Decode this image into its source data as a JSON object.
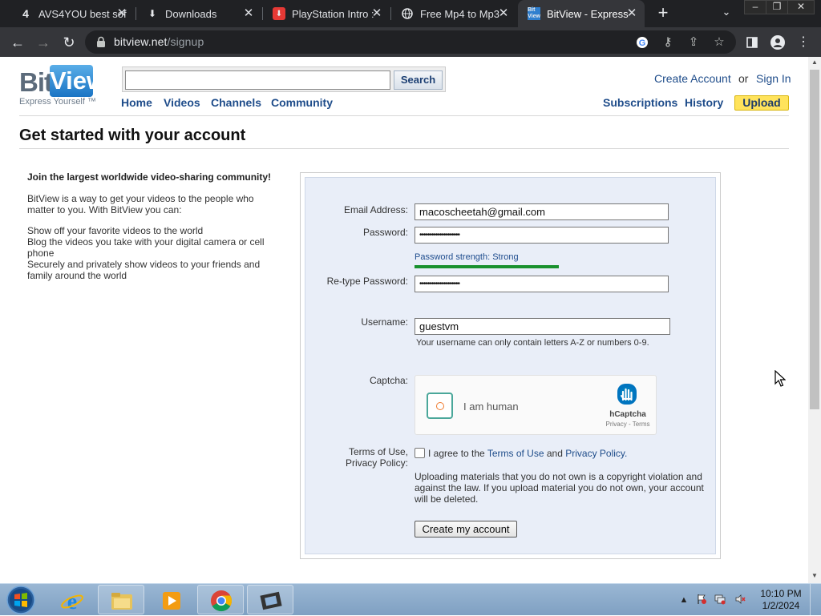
{
  "browser": {
    "tabs": [
      {
        "title": "AVS4YOU best sof",
        "icon": "4"
      },
      {
        "title": "Downloads",
        "icon": "download-icon"
      },
      {
        "title": "PlayStation Intro :",
        "icon": "download-red-icon"
      },
      {
        "title": "Free Mp4 to Mp3",
        "icon": "globe-icon"
      },
      {
        "title": "BitView - Express",
        "icon": "bitview-favicon"
      }
    ],
    "url_domain": "bitview.net",
    "url_path": "/signup"
  },
  "site": {
    "logo_bit": "Bit",
    "logo_view": "View",
    "tagline": "Express Yourself ™",
    "search_button": "Search",
    "search_value": "",
    "nav": {
      "home": "Home",
      "videos": "Videos",
      "channels": "Channels",
      "community": "Community"
    },
    "create_account": "Create Account",
    "or": "or",
    "sign_in": "Sign In",
    "subscriptions": "Subscriptions",
    "history": "History",
    "upload": "Upload"
  },
  "page": {
    "title": "Get started with your account",
    "intro_heading": "Join the largest worldwide video-sharing community!",
    "intro_text": "BitView is a way to get your videos to the people who matter to you. With BitView you can:",
    "bullets": [
      "Show off your favorite videos to the world",
      "Blog the videos you take with your digital camera or cell phone",
      "Securely and privately show videos to your friends and family around the world"
    ]
  },
  "form": {
    "email_label": "Email Address:",
    "email_value": "macoscheetah@gmail.com",
    "password_label": "Password:",
    "password_value": "••••••••••••••••••••",
    "password_strength": "Password strength: Strong",
    "password_strength_level": 1.0,
    "retype_label": "Re-type Password:",
    "retype_value": "••••••••••••••••••••",
    "username_label": "Username:",
    "username_value": "guestvm",
    "username_hint": "Your username can only contain letters A-Z or numbers 0-9.",
    "captcha_label": "Captcha:",
    "captcha_text": "I am human",
    "captcha_brand": "hCaptcha",
    "captcha_links": "Privacy - Terms",
    "terms_label_line1": "Terms of Use,",
    "terms_label_line2": "Privacy Policy:",
    "terms_agree": "I agree to the",
    "terms_link": "Terms of Use",
    "terms_and": "and",
    "privacy_link": "Privacy Policy.",
    "notice": "Uploading materials that you do not own is a copyright violation and against the law. If you upload material you do not own, your account will be deleted.",
    "submit": "Create my account"
  },
  "taskbar": {
    "time": "10:10 PM",
    "date": "1/2/2024"
  },
  "colors": {
    "link": "#1e4c8a",
    "upload_bg": "#ffe35b",
    "form_bg": "#e9eef8",
    "strength_bar": "#19912e"
  }
}
